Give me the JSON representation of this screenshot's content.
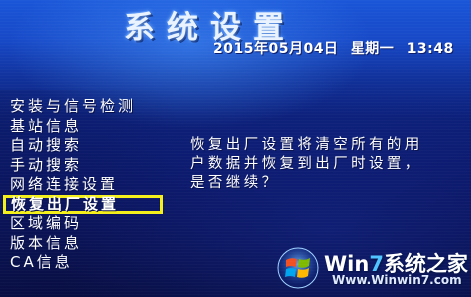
{
  "screen": {
    "title": "系统设置",
    "date": "2015年05月04日",
    "weekday": "星期一",
    "time": "13:48"
  },
  "menu": {
    "items": [
      {
        "label": "安装与信号检测"
      },
      {
        "label": "基站信息"
      },
      {
        "label": "自动搜索"
      },
      {
        "label": "手动搜索"
      },
      {
        "label": "网络连接设置"
      },
      {
        "label": "恢复出厂设置"
      },
      {
        "label": "区域编码"
      },
      {
        "label": "版本信息"
      },
      {
        "label": "CA信息"
      }
    ],
    "selected_index": 5
  },
  "message": {
    "lines": [
      "恢复出厂设置将清空所有的用",
      "户数据并恢复到出厂时设置，",
      "是否继续？"
    ]
  },
  "watermark": {
    "brand_prefix": "Win",
    "brand_digit": "7",
    "brand_suffix": "系统之家",
    "url": "Www.Winwin7.com"
  },
  "colors": {
    "background_top": "#1a56d8",
    "background_bottom": "#080d3f",
    "highlight_border": "#f4ef1a",
    "text": "#ffffff"
  }
}
